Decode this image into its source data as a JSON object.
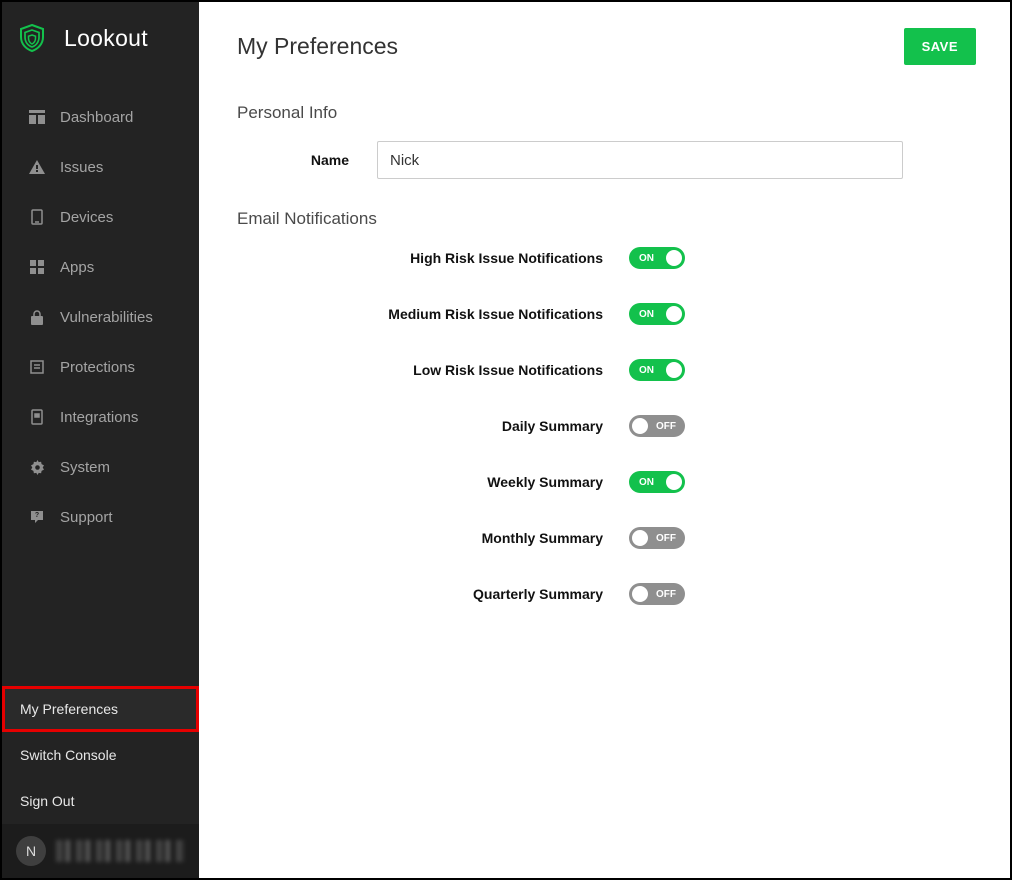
{
  "brand": "Lookout",
  "header": {
    "title": "My Preferences",
    "save_label": "SAVE"
  },
  "sidebar": {
    "items": [
      {
        "label": "Dashboard"
      },
      {
        "label": "Issues"
      },
      {
        "label": "Devices"
      },
      {
        "label": "Apps"
      },
      {
        "label": "Vulnerabilities"
      },
      {
        "label": "Protections"
      },
      {
        "label": "Integrations"
      },
      {
        "label": "System"
      },
      {
        "label": "Support"
      }
    ],
    "footer": {
      "my_preferences": "My Preferences",
      "switch_console": "Switch Console",
      "sign_out": "Sign Out",
      "avatar_initial": "N"
    }
  },
  "personal": {
    "section_title": "Personal Info",
    "name_label": "Name",
    "name_value": "Nick"
  },
  "email": {
    "section_title": "Email Notifications",
    "on_label": "ON",
    "off_label": "OFF",
    "rows": [
      {
        "label": "High Risk Issue Notifications",
        "state": "on"
      },
      {
        "label": "Medium Risk Issue Notifications",
        "state": "on"
      },
      {
        "label": "Low Risk Issue Notifications",
        "state": "on"
      },
      {
        "label": "Daily Summary",
        "state": "off"
      },
      {
        "label": "Weekly Summary",
        "state": "on"
      },
      {
        "label": "Monthly Summary",
        "state": "off"
      },
      {
        "label": "Quarterly Summary",
        "state": "off"
      }
    ]
  }
}
